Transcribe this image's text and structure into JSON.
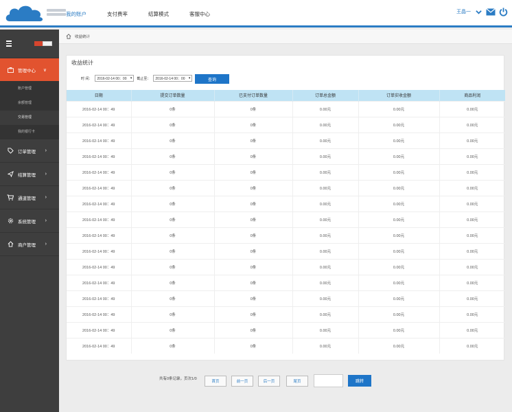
{
  "header": {
    "nav": [
      "我的账户",
      "支付费率",
      "结算模式",
      "客服中心"
    ],
    "user_name": "王晶一",
    "icons": [
      "chevron-down-icon",
      "mail-icon",
      "power-icon"
    ]
  },
  "sidebar": {
    "items": [
      {
        "label": "管理中心",
        "icon": "briefcase-icon",
        "active": true
      },
      {
        "label": "订单管理",
        "icon": "tag-icon"
      },
      {
        "label": "结算管理",
        "icon": "send-icon"
      },
      {
        "label": "通道管理",
        "icon": "cart-icon"
      },
      {
        "label": "系统管理",
        "icon": "gear-icon"
      },
      {
        "label": "商户管理",
        "icon": "home-icon"
      }
    ],
    "subitems": [
      "账户管理",
      "余额管理",
      "交易管理",
      "我的银行卡"
    ]
  },
  "breadcrumb": "收益统计",
  "panel": {
    "title": "收益统计",
    "time_label": "时  间：",
    "start_value": "2016-02-14 00：00",
    "to_label": "截止至：",
    "end_value": "2016-02-14 00：00",
    "query_label": "查询"
  },
  "table": {
    "headers": [
      "日期",
      "提交订单数量",
      "已支付订单数量",
      "订单总金额",
      "订单实收金额",
      "商品利润"
    ],
    "rows": [
      [
        "2016-02-14 00：49",
        "0条",
        "0条",
        "0.00元",
        "0.00元",
        "0.00元"
      ],
      [
        "2016-02-14 00：49",
        "0条",
        "0条",
        "0.00元",
        "0.00元",
        "0.00元"
      ],
      [
        "2016-02-14 00：49",
        "0条",
        "0条",
        "0.00元",
        "0.00元",
        "0.00元"
      ],
      [
        "2016-02-14 00：49",
        "0条",
        "0条",
        "0.00元",
        "0.00元",
        "0.00元"
      ],
      [
        "2016-02-14 00：49",
        "0条",
        "0条",
        "0.00元",
        "0.00元",
        "0.00元"
      ],
      [
        "2016-02-14 00：49",
        "0条",
        "0条",
        "0.00元",
        "0.00元",
        "0.00元"
      ],
      [
        "2016-02-14 00：49",
        "0条",
        "0条",
        "0.00元",
        "0.00元",
        "0.00元"
      ],
      [
        "2016-02-14 00：49",
        "0条",
        "0条",
        "0.00元",
        "0.00元",
        "0.00元"
      ],
      [
        "2016-02-14 00：49",
        "0条",
        "0条",
        "0.00元",
        "0.00元",
        "0.00元"
      ],
      [
        "2016-02-14 00：49",
        "0条",
        "0条",
        "0.00元",
        "0.00元",
        "0.00元"
      ],
      [
        "2016-02-14 00：49",
        "0条",
        "0条",
        "0.00元",
        "0.00元",
        "0.00元"
      ],
      [
        "2016-02-14 00：49",
        "0条",
        "0条",
        "0.00元",
        "0.00元",
        "0.00元"
      ],
      [
        "2016-02-14 00：49",
        "0条",
        "0条",
        "0.00元",
        "0.00元",
        "0.00元"
      ],
      [
        "2016-02-14 00：49",
        "0条",
        "0条",
        "0.00元",
        "0.00元",
        "0.00元"
      ],
      [
        "2016-02-14 00：49",
        "0条",
        "0条",
        "0.00元",
        "0.00元",
        "0.00元"
      ],
      [
        "2016-02-14 00：49",
        "0条",
        "0条",
        "0.00元",
        "0.00元",
        "0.00元"
      ]
    ]
  },
  "pager": {
    "summary": "共有0条记录，页次1/0",
    "first": "首页",
    "prev": "前一页",
    "next": "后一页",
    "last": "尾页",
    "go": "跳转"
  },
  "colors": {
    "accent": "#2b7cc4",
    "sidebar_bg": "#3e3e3e",
    "active": "#e2532f",
    "table_head": "#bfe3f4"
  }
}
